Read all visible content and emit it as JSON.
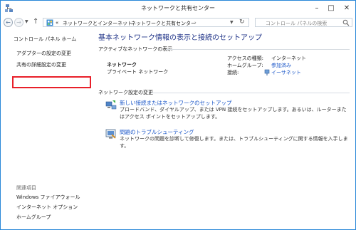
{
  "window": {
    "title": "ネットワークと共有センター"
  },
  "navbar": {
    "breadcrumbs": [
      "«",
      "ネットワークとインターネット",
      "ネットワークと共有センター"
    ],
    "search_placeholder": "コントロール パネルの検索"
  },
  "sidebar": {
    "home": "コントロール パネル ホーム",
    "links": [
      "アダプターの設定の変更",
      "共有の詳細設定の変更"
    ],
    "related_heading": "関連項目",
    "related": [
      "Windows ファイアウォール",
      "インターネット オプション",
      "ホームグループ"
    ]
  },
  "main": {
    "title": "基本ネットワーク情報の表示と接続のセットアップ",
    "active_heading": "アクティブなネットワークの表示",
    "network": {
      "name": "ネットワーク",
      "type": "プライベート ネットワーク",
      "props": [
        {
          "label": "アクセスの種類:",
          "value": "インターネット",
          "is_link": false
        },
        {
          "label": "ホームグループ:",
          "value": "参加済み",
          "is_link": true
        },
        {
          "label": "接続:",
          "value": "イーサネット",
          "is_link": true
        }
      ]
    },
    "settings_heading": "ネットワーク設定の変更",
    "tasks": [
      {
        "link": "新しい接続またはネットワークのセットアップ",
        "desc": "ブロードバンド、ダイヤルアップ、または VPN 接続をセットアップします。あるいは、ルーターまたはアクセス ポイントをセットアップします。",
        "icon": "network-setup-icon"
      },
      {
        "link": "問題のトラブルシューティング",
        "desc": "ネットワークの問題を診断して修復します。または、トラブルシューティングに関する情報を入手します。",
        "icon": "troubleshoot-icon"
      }
    ]
  },
  "colors": {
    "accent_border": "#2a88d8",
    "title_blue": "#1e3287",
    "link_blue": "#1a56c8",
    "highlight_red": "#e8202a"
  }
}
